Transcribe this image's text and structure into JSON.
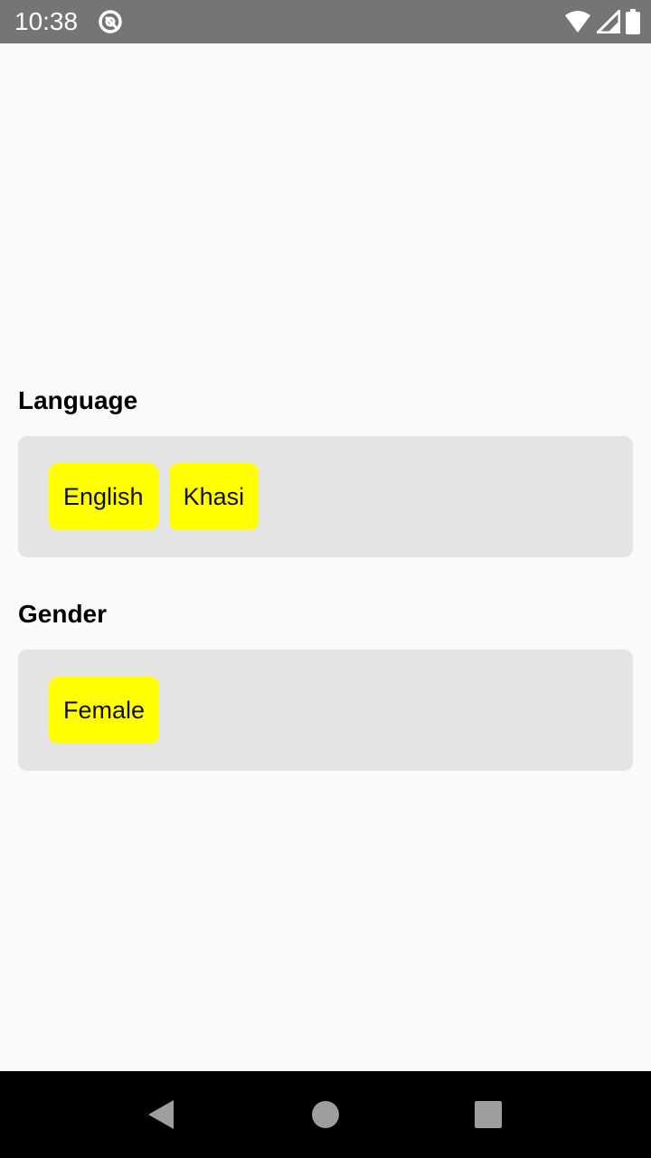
{
  "status_bar": {
    "time": "10:38",
    "app_icon": "at-sign-icon",
    "wifi_icon": "wifi-icon",
    "signal_icon": "cell-signal-icon",
    "battery_icon": "battery-icon"
  },
  "sections": [
    {
      "title": "Language",
      "chips": [
        "English",
        "Khasi"
      ]
    },
    {
      "title": "Gender",
      "chips": [
        "Female"
      ]
    }
  ],
  "colors": {
    "chip_background": "#ffff00",
    "box_background": "#e4e4e4",
    "status_bar": "#757575",
    "nav_bar": "#000000"
  },
  "nav_bar": {
    "back_icon": "back-triangle-icon",
    "home_icon": "home-circle-icon",
    "recents_icon": "recents-square-icon"
  }
}
